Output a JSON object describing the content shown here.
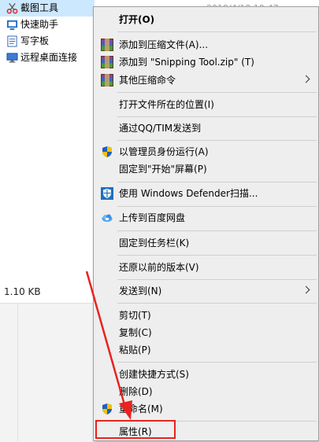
{
  "explorer": {
    "files": [
      {
        "name": "截图工具",
        "icon": "scissors-icon"
      },
      {
        "name": "快速助手",
        "icon": "quick-assist-icon"
      },
      {
        "name": "写字板",
        "icon": "wordpad-icon"
      },
      {
        "name": "远程桌面连接",
        "icon": "remote-desktop-icon"
      }
    ],
    "date_fragment": "2019/4/18 19:47",
    "selected_size": "1.10 KB"
  },
  "context_menu": {
    "items": [
      {
        "label": "打开(O)",
        "bold": true,
        "icon": null
      },
      {
        "label": "添加到压缩文件(A)...",
        "icon": "winrar-icon"
      },
      {
        "label": "添加到 \"Snipping Tool.zip\" (T)",
        "icon": "winrar-icon"
      },
      {
        "label": "其他压缩命令",
        "icon": "winrar-icon",
        "submenu": true
      },
      {
        "label": "打开文件所在的位置(I)",
        "icon": null
      },
      {
        "label": "通过QQ/TIM发送到",
        "icon": null
      },
      {
        "label": "以管理员身份运行(A)",
        "icon": "uac-shield-icon"
      },
      {
        "label": "固定到\"开始\"屏幕(P)",
        "icon": null
      },
      {
        "label": "使用 Windows Defender扫描...",
        "icon": "windows-defender-icon"
      },
      {
        "label": "上传到百度网盘",
        "icon": "baidu-netdisk-icon"
      },
      {
        "label": "固定到任务栏(K)",
        "icon": null
      },
      {
        "label": "还原以前的版本(V)",
        "icon": null
      },
      {
        "label": "发送到(N)",
        "icon": null,
        "submenu": true
      },
      {
        "label": "剪切(T)",
        "icon": null
      },
      {
        "label": "复制(C)",
        "icon": null
      },
      {
        "label": "粘贴(P)",
        "icon": null
      },
      {
        "label": "创建快捷方式(S)",
        "icon": null
      },
      {
        "label": "删除(D)",
        "icon": null
      },
      {
        "label": "重命名(M)",
        "icon": "uac-shield-icon"
      },
      {
        "label": "属性(R)",
        "icon": null,
        "highlighted": true
      }
    ]
  },
  "colors": {
    "highlight": "#e8231f",
    "selection": "#cce8ff",
    "menu_background": "#eeeeee"
  }
}
